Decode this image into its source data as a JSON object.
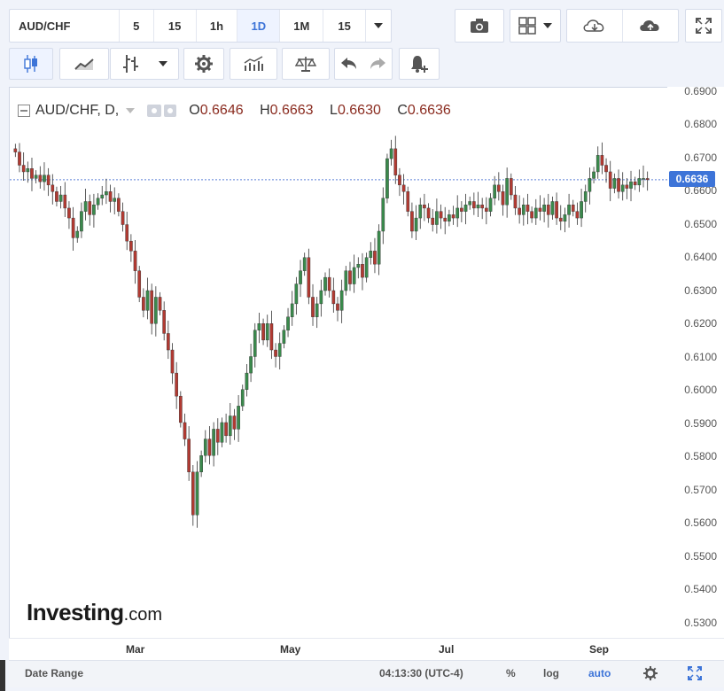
{
  "toolbar": {
    "symbol": "AUD/CHF",
    "intervals": [
      "5",
      "15",
      "1h",
      "1D",
      "1M",
      "15"
    ],
    "active_interval": "1D",
    "dropdown_icon": "caret-down-icon",
    "camera_icon": "camera-icon",
    "layout_icon": "grid-layout-icon",
    "cloud_download_icon": "cloud-download-icon",
    "cloud_upload_icon": "cloud-upload-icon",
    "fullscreen_icon": "fullscreen-icon"
  },
  "toolbar2": {
    "candles_icon": "candlestick-icon",
    "line_icon": "line-chart-icon",
    "bar_icon": "bar-chart-icon",
    "settings_icon": "gear-icon",
    "indicators_icon": "indicators-icon",
    "compare_icon": "balance-scale-icon",
    "undo_icon": "undo-icon",
    "redo_icon": "redo-icon",
    "alert_icon": "alert-bell-icon"
  },
  "legend": {
    "title": "AUD/CHF, D,",
    "open": "0.6646",
    "high": "0.6663",
    "low": "0.6630",
    "close": "0.6636",
    "open_label": "O",
    "high_label": "H",
    "low_label": "L",
    "close_label": "C"
  },
  "price_tag": "0.6636",
  "colors": {
    "up": "#3a8a4c",
    "down": "#b23a32",
    "accent": "#3d74d8",
    "line": "#5b7fd6"
  },
  "chart_data": {
    "type": "candlestick",
    "y_range": [
      0.525,
      0.6915
    ],
    "y_ticks": [
      "0.6900",
      "0.6800",
      "0.6700",
      "0.6600",
      "0.6500",
      "0.6400",
      "0.6300",
      "0.6200",
      "0.6100",
      "0.6000",
      "0.5900",
      "0.5800",
      "0.5700",
      "0.5600",
      "0.5500",
      "0.5400",
      "0.5300"
    ],
    "x_labels": [
      "Mar",
      "May",
      "Jul",
      "Sep"
    ],
    "last_price": 0.6636,
    "closes": [
      0.672,
      0.668,
      0.666,
      0.667,
      0.664,
      0.665,
      0.663,
      0.665,
      0.662,
      0.66,
      0.657,
      0.659,
      0.655,
      0.652,
      0.646,
      0.648,
      0.654,
      0.657,
      0.653,
      0.656,
      0.658,
      0.659,
      0.66,
      0.657,
      0.658,
      0.654,
      0.65,
      0.645,
      0.642,
      0.636,
      0.628,
      0.624,
      0.63,
      0.62,
      0.628,
      0.624,
      0.617,
      0.612,
      0.605,
      0.598,
      0.59,
      0.585,
      0.575,
      0.562,
      0.575,
      0.58,
      0.585,
      0.58,
      0.588,
      0.584,
      0.59,
      0.586,
      0.592,
      0.588,
      0.595,
      0.6,
      0.605,
      0.61,
      0.618,
      0.62,
      0.615,
      0.62,
      0.612,
      0.61,
      0.614,
      0.618,
      0.622,
      0.626,
      0.632,
      0.636,
      0.64,
      0.628,
      0.622,
      0.626,
      0.63,
      0.634,
      0.63,
      0.626,
      0.624,
      0.63,
      0.636,
      0.632,
      0.637,
      0.638,
      0.634,
      0.64,
      0.642,
      0.638,
      0.648,
      0.658,
      0.67,
      0.673,
      0.665,
      0.662,
      0.66,
      0.654,
      0.648,
      0.652,
      0.656,
      0.655,
      0.652,
      0.65,
      0.654,
      0.652,
      0.651,
      0.653,
      0.652,
      0.655,
      0.654,
      0.656,
      0.657,
      0.655,
      0.656,
      0.655,
      0.654,
      0.658,
      0.662,
      0.66,
      0.656,
      0.664,
      0.659,
      0.655,
      0.653,
      0.656,
      0.654,
      0.652,
      0.655,
      0.654,
      0.656,
      0.653,
      0.657,
      0.652,
      0.651,
      0.653,
      0.656,
      0.654,
      0.652,
      0.657,
      0.66,
      0.664,
      0.666,
      0.671,
      0.668,
      0.666,
      0.661,
      0.664,
      0.66,
      0.662,
      0.661,
      0.663,
      0.662,
      0.664,
      0.664,
      0.6636
    ]
  },
  "bottombar": {
    "date_range": "Date Range",
    "clock": "04:13:30 (UTC-4)",
    "percent": "%",
    "log": "log",
    "auto": "auto",
    "settings_icon": "gear-icon",
    "expand_icon": "expand-icon"
  },
  "logo": {
    "brand": "Investing",
    "suffix": ".com"
  }
}
